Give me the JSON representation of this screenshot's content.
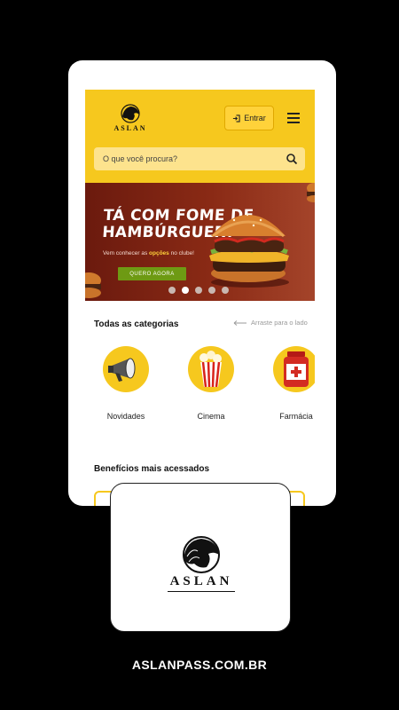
{
  "header": {
    "brand": "ASLAN",
    "login_label": "Entrar"
  },
  "search": {
    "placeholder": "O que você procura?"
  },
  "banner": {
    "title_line1": "TÁ COM FOME DE",
    "title_line2": "HAMBÚRGUER?",
    "subtitle_prefix": "Vem conhecer as ",
    "subtitle_highlight": "opções",
    "subtitle_suffix": " no clube!",
    "cta_label": "QUERO AGORA",
    "slide_count": 5,
    "active_slide": 2
  },
  "categories": {
    "title": "Todas as categorias",
    "hint": "Arraste para o lado",
    "items": [
      {
        "label": "Novidades",
        "icon": "megaphone-icon"
      },
      {
        "label": "Cinema",
        "icon": "popcorn-icon"
      },
      {
        "label": "Farmácia",
        "icon": "medicine-bottle-icon"
      }
    ]
  },
  "benefits": {
    "title": "Benefícios mais acessados"
  },
  "logo_card": {
    "brand": "ASLAN"
  },
  "footer": {
    "url": "ASLANPASS.COM.BR"
  },
  "colors": {
    "brand_yellow": "#f6c81e",
    "banner_red": "#7a2212",
    "cta_green": "#6e9a13",
    "background": "#000000"
  }
}
